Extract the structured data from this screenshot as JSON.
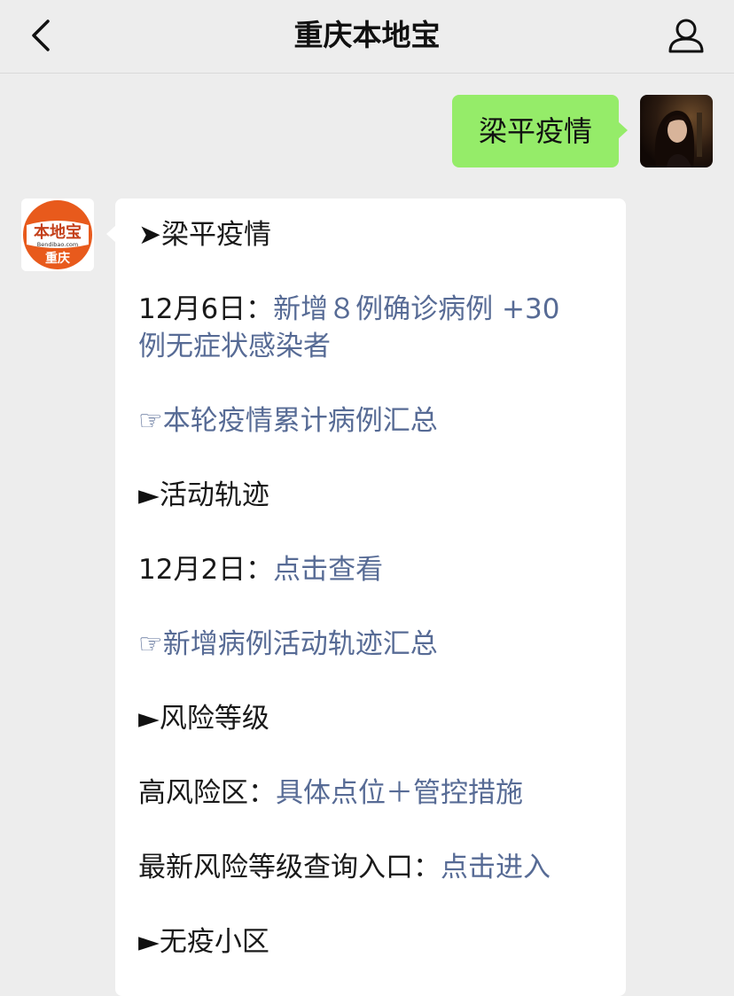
{
  "nav": {
    "title": "重庆本地宝",
    "back_icon": "chevron-left-icon",
    "profile_icon": "person-icon"
  },
  "chat": {
    "outgoing_message": "梁平疫情",
    "bot_avatar": {
      "logo_text": "本地宝",
      "domain": "Bendibao.com",
      "city": "重庆"
    },
    "reply": {
      "s1_marker": "➤",
      "s1_title": "梁平疫情",
      "d1_prefix": "12月6日：",
      "d1_link_a": "新增８例确诊病例 +30",
      "d1_link_b": "例无症状感染者",
      "l1_icon": "☞",
      "l1_text": "本轮疫情累计病例汇总",
      "s2_marker": "►",
      "s2_title": "活动轨迹",
      "d2_prefix": "12月2日：",
      "d2_link": "点击查看",
      "l2_icon": "☞",
      "l2_text": "新增病例活动轨迹汇总",
      "s3_marker": "►",
      "s3_title": "风险等级",
      "r1_prefix": "高风险区：",
      "r1_link": "具体点位＋管控措施",
      "r2_prefix": "最新风险等级查询入口：",
      "r2_link": "点击进入",
      "s4_marker": "►",
      "s4_title": "无疫小区"
    }
  },
  "colors": {
    "background": "#ededed",
    "outgoing_bubble": "#95ec69",
    "link": "#576b95",
    "brand_orange": "#e85a1c"
  }
}
